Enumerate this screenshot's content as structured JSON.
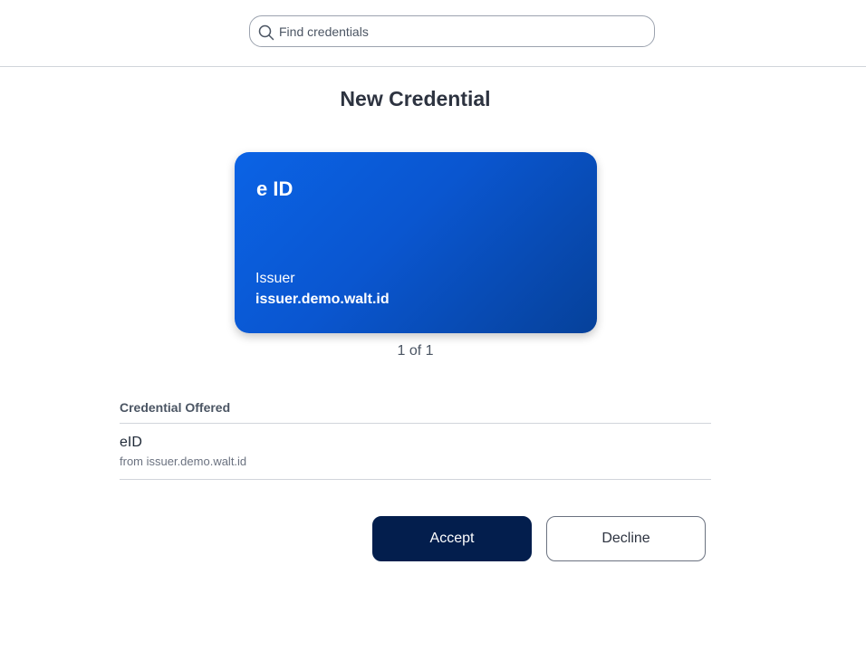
{
  "search": {
    "placeholder": "Find credentials",
    "icon": "search-icon"
  },
  "page": {
    "title": "New Credential"
  },
  "card": {
    "title": "e ID",
    "issuer_label": "Issuer",
    "issuer_value": "issuer.demo.walt.id",
    "gradient_start": "#0b63e5",
    "gradient_end": "#06419a"
  },
  "pager": {
    "text": "1 of 1"
  },
  "offered": {
    "heading": "Credential Offered",
    "items": [
      {
        "name": "eID",
        "from": "from issuer.demo.walt.id"
      }
    ]
  },
  "actions": {
    "accept_label": "Accept",
    "decline_label": "Decline",
    "accept_color": "#031e4d"
  }
}
